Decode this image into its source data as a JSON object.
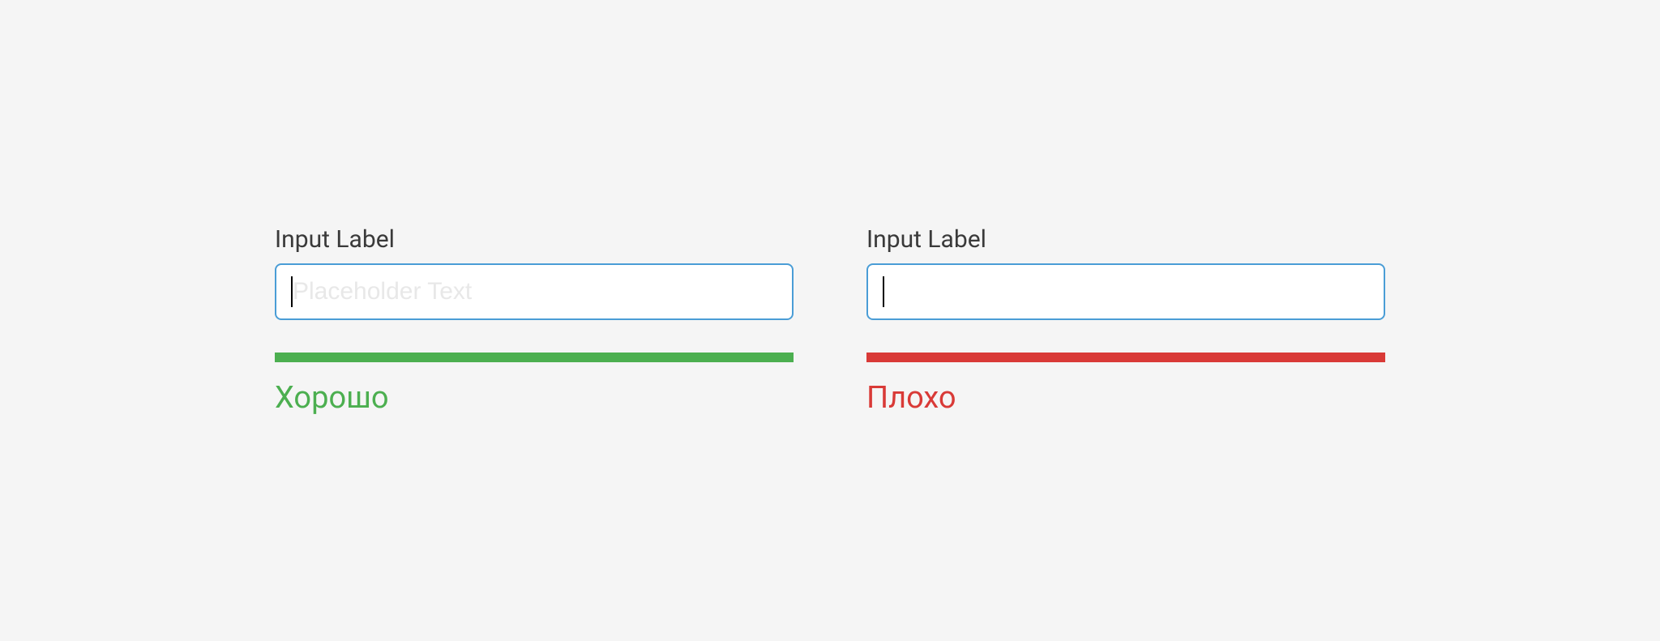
{
  "good": {
    "label": "Input Label",
    "placeholder": "Placeholder Text",
    "status": "Хорошо",
    "color": "#4caf50"
  },
  "bad": {
    "label": "Input Label",
    "placeholder": "",
    "status": "Плохо",
    "color": "#d93a37"
  }
}
